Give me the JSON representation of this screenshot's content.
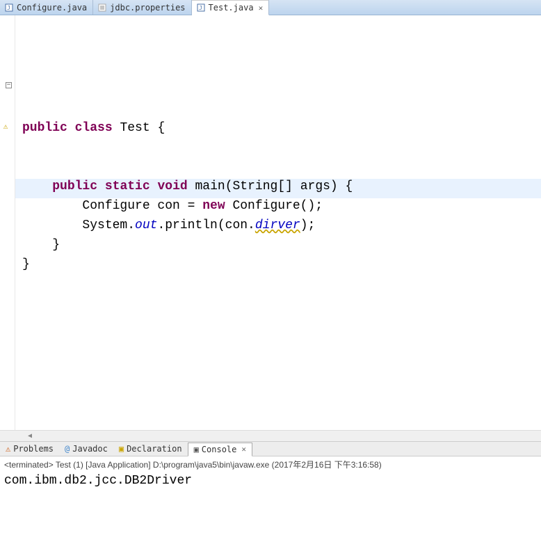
{
  "tabs": {
    "t0": "Configure.java",
    "t1": "jdbc.properties",
    "t2": "Test.java"
  },
  "code": {
    "l1a": "public",
    "l1b": " ",
    "l1c": "class",
    "l1d": " Test {",
    "l2a": "    ",
    "l2b": "public",
    "l2c": " ",
    "l2d": "static",
    "l2e": " ",
    "l2f": "void",
    "l2g": " main(String[] args) {",
    "l3a": "        Configure con = ",
    "l3b": "new",
    "l3c": " Configure();",
    "l4a": "        System.",
    "l4b": "out",
    "l4c": ".println(con.",
    "l4d": "dirver",
    "l4e": ");",
    "l5": "    }",
    "l6": "}"
  },
  "bottomTabs": {
    "problems": "Problems",
    "javadoc": "Javadoc",
    "declaration": "Declaration",
    "console": "Console"
  },
  "console": {
    "status": "<terminated> Test (1) [Java Application] D:\\program\\java5\\bin\\javaw.exe (2017年2月16日 下午3:16:58)",
    "output": "com.ibm.db2.jcc.DB2Driver"
  }
}
